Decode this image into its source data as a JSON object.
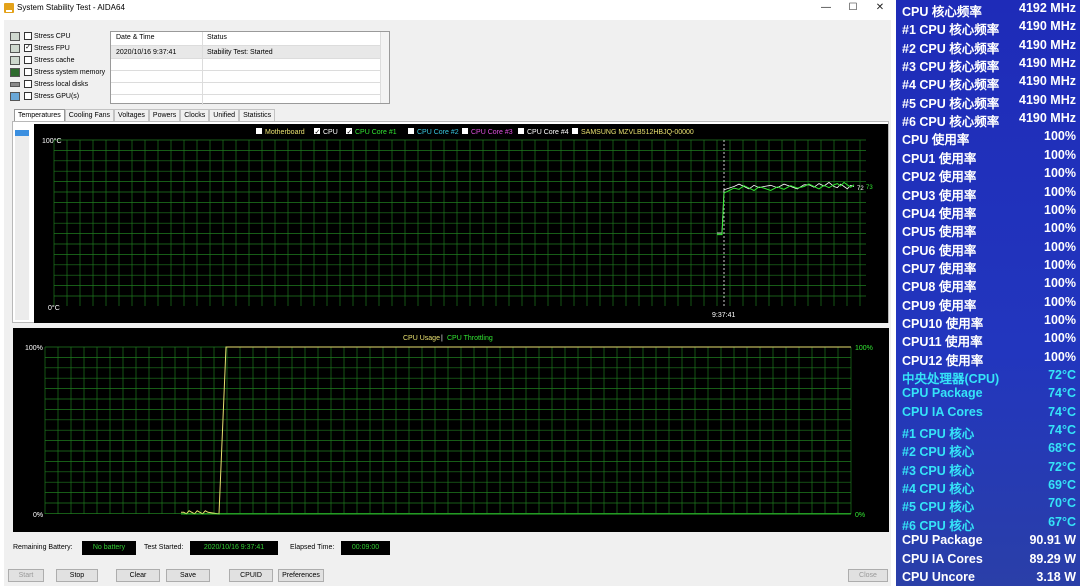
{
  "window": {
    "title": "System Stability Test - AIDA64",
    "controls": {
      "minimize": "—",
      "maximize": "☐",
      "close": "✕"
    }
  },
  "stress_options": [
    {
      "label": "Stress CPU",
      "checked": false
    },
    {
      "label": "Stress FPU",
      "checked": true
    },
    {
      "label": "Stress cache",
      "checked": false
    },
    {
      "label": "Stress system memory",
      "checked": false
    },
    {
      "label": "Stress local disks",
      "checked": false
    },
    {
      "label": "Stress GPU(s)",
      "checked": false
    }
  ],
  "status_table": {
    "headers": {
      "datetime": "Date & Time",
      "status": "Status"
    },
    "rows": [
      {
        "datetime": "2020/10/16 9:37:41",
        "status": "Stability Test: Started"
      }
    ]
  },
  "tabs": [
    "Temperatures",
    "Cooling Fans",
    "Voltages",
    "Powers",
    "Clocks",
    "Unified",
    "Statistics"
  ],
  "temp_graph": {
    "legend": [
      {
        "label": "Motherboard",
        "checked": false,
        "color": "#e8e070"
      },
      {
        "label": "CPU",
        "checked": true,
        "color": "#ffffff"
      },
      {
        "label": "CPU Core #1",
        "checked": true,
        "color": "#32e632"
      },
      {
        "label": "CPU Core #2",
        "checked": false,
        "color": "#38c8e0"
      },
      {
        "label": "CPU Core #3",
        "checked": false,
        "color": "#e050e0"
      },
      {
        "label": "CPU Core #4",
        "checked": false,
        "color": "#ffffff"
      },
      {
        "label": "SAMSUNG MZVLB512HBJQ-00000",
        "checked": false,
        "color": "#e8e070"
      }
    ],
    "y_max_label": "100°C",
    "y_min_label": "0°C",
    "time_label": "9:37:41",
    "end_value_labels": [
      "72",
      "73"
    ]
  },
  "usage_graph": {
    "legend_usage": "CPU Usage",
    "legend_sep": "|",
    "legend_throttling": "CPU Throttling",
    "y_max_left": "100%",
    "y_min_left": "0%",
    "y_max_right": "100%",
    "y_min_right": "0%"
  },
  "chart_data": [
    {
      "type": "line",
      "series": [
        {
          "name": "CPU",
          "color": "#ffffff",
          "values": [
            44,
            44,
            70,
            72,
            72,
            73,
            72,
            72
          ]
        },
        {
          "name": "CPU Core #1",
          "color": "#32e632",
          "values": [
            43,
            43,
            68,
            71,
            71,
            72,
            73,
            73
          ]
        }
      ],
      "ylim": [
        0,
        100
      ]
    },
    {
      "type": "line",
      "series": [
        {
          "name": "CPU Usage",
          "color": "#e8e070",
          "values": [
            1,
            1,
            0,
            100,
            100,
            100,
            100
          ]
        },
        {
          "name": "CPU Throttling",
          "color": "#32e632",
          "values": [
            0,
            0,
            0,
            0,
            0,
            0,
            0
          ]
        }
      ],
      "ylim": [
        0,
        100
      ]
    }
  ],
  "footer": {
    "battery_label": "Remaining Battery:",
    "battery_value": "No battery",
    "started_label": "Test Started:",
    "started_value": "2020/10/16 9:37:41",
    "elapsed_label": "Elapsed Time:",
    "elapsed_value": "00:09:00"
  },
  "buttons": {
    "start": "Start",
    "stop": "Stop",
    "clear": "Clear",
    "save": "Save",
    "cpuid": "CPUID",
    "preferences": "Preferences",
    "close": "Close"
  },
  "osd": {
    "colors": {
      "freq": "#ffffff",
      "usage": "#ffffff",
      "temp": "#35e4f8",
      "power": "#ffffff"
    },
    "rows": [
      {
        "label": "CPU 核心频率",
        "value": "4192 MHz",
        "kind": "freq"
      },
      {
        "label": "#1 CPU 核心频率",
        "value": "4190 MHz",
        "kind": "freq"
      },
      {
        "label": "#2 CPU 核心频率",
        "value": "4190 MHz",
        "kind": "freq"
      },
      {
        "label": "#3 CPU 核心频率",
        "value": "4190 MHz",
        "kind": "freq"
      },
      {
        "label": "#4 CPU 核心频率",
        "value": "4190 MHz",
        "kind": "freq"
      },
      {
        "label": "#5 CPU 核心频率",
        "value": "4190 MHz",
        "kind": "freq"
      },
      {
        "label": "#6 CPU 核心频率",
        "value": "4190 MHz",
        "kind": "freq"
      },
      {
        "label": "CPU 使用率",
        "value": "100%",
        "kind": "usage"
      },
      {
        "label": "CPU1 使用率",
        "value": "100%",
        "kind": "usage"
      },
      {
        "label": "CPU2 使用率",
        "value": "100%",
        "kind": "usage"
      },
      {
        "label": "CPU3 使用率",
        "value": "100%",
        "kind": "usage"
      },
      {
        "label": "CPU4 使用率",
        "value": "100%",
        "kind": "usage"
      },
      {
        "label": "CPU5 使用率",
        "value": "100%",
        "kind": "usage"
      },
      {
        "label": "CPU6 使用率",
        "value": "100%",
        "kind": "usage"
      },
      {
        "label": "CPU7 使用率",
        "value": "100%",
        "kind": "usage"
      },
      {
        "label": "CPU8 使用率",
        "value": "100%",
        "kind": "usage"
      },
      {
        "label": "CPU9 使用率",
        "value": "100%",
        "kind": "usage"
      },
      {
        "label": "CPU10 使用率",
        "value": "100%",
        "kind": "usage"
      },
      {
        "label": "CPU11 使用率",
        "value": "100%",
        "kind": "usage"
      },
      {
        "label": "CPU12 使用率",
        "value": "100%",
        "kind": "usage"
      },
      {
        "label": "中央处理器(CPU)",
        "value": "72°C",
        "kind": "temp"
      },
      {
        "label": "CPU Package",
        "value": "74°C",
        "kind": "temp"
      },
      {
        "label": "CPU IA Cores",
        "value": "74°C",
        "kind": "temp"
      },
      {
        "label": " #1 CPU 核心",
        "value": "74°C",
        "kind": "temp"
      },
      {
        "label": " #2 CPU 核心",
        "value": "68°C",
        "kind": "temp"
      },
      {
        "label": " #3 CPU 核心",
        "value": "72°C",
        "kind": "temp"
      },
      {
        "label": " #4 CPU 核心",
        "value": "69°C",
        "kind": "temp"
      },
      {
        "label": " #5 CPU 核心",
        "value": "70°C",
        "kind": "temp"
      },
      {
        "label": " #6 CPU 核心",
        "value": "67°C",
        "kind": "temp"
      },
      {
        "label": "CPU Package",
        "value": "90.91 W",
        "kind": "power"
      },
      {
        "label": "CPU IA Cores",
        "value": "89.29 W",
        "kind": "power"
      },
      {
        "label": "CPU Uncore",
        "value": "3.18 W",
        "kind": "power"
      }
    ]
  }
}
